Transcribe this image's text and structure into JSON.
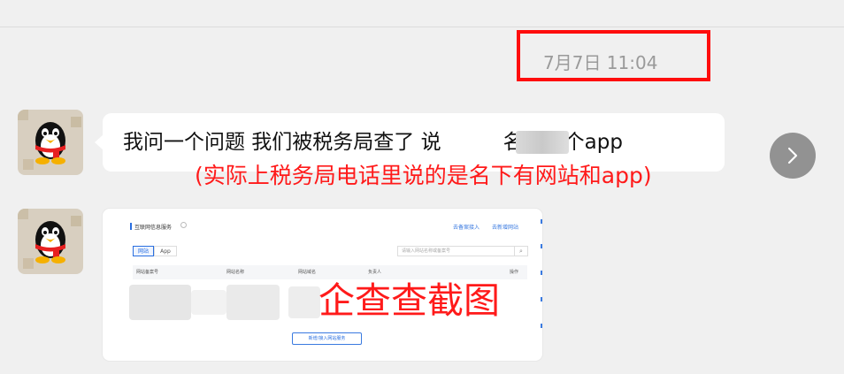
{
  "chat": {
    "timestamp": "7月7日 11:04",
    "messages": [
      {
        "sender": "qq-penguin-avatar",
        "text_before": "我问一个问题 我们被税务局查了 说",
        "text_after": "名下有个app",
        "annotation": "(实际上税务局电话里说的是名下有网站和app)"
      },
      {
        "sender": "qq-penguin-avatar",
        "type": "image",
        "screenshot": {
          "title": "互联网信息服务",
          "links": [
            "去备案接入",
            "去新增网站"
          ],
          "tabs": [
            "网站",
            "App"
          ],
          "search_placeholder": "请输入网站名称或备案号",
          "columns": [
            "网站备案号",
            "网站名称",
            "网站域名",
            "负责人",
            "操作"
          ],
          "add_button": "新增/接入网站服务",
          "watermark": "企查查截图"
        }
      }
    ]
  },
  "icons": {
    "next": "chevron-right-icon",
    "avatar": "qq-penguin-avatar"
  },
  "colors": {
    "background": "#f0f0f0",
    "bubble": "#ffffff",
    "annotation": "#ff1a1a",
    "link": "#3a7ae0",
    "timestamp": "#9a9a9a"
  }
}
